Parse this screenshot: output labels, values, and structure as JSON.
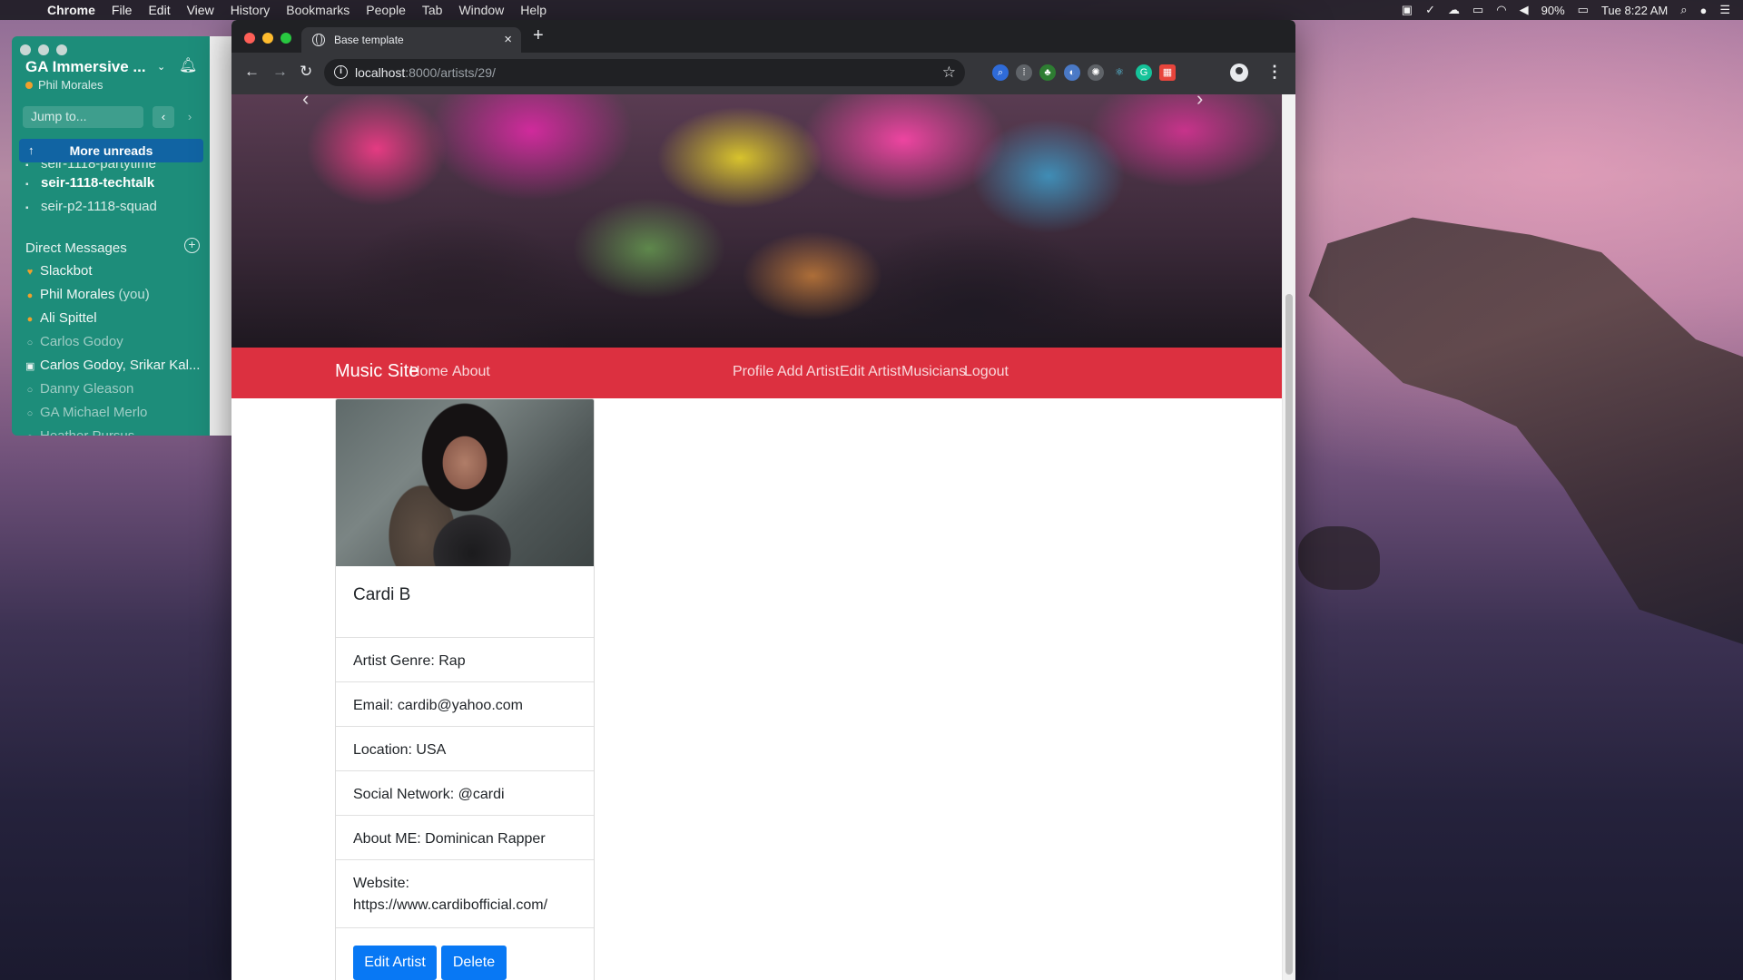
{
  "menubar": {
    "items": [
      "Chrome",
      "File",
      "Edit",
      "View",
      "History",
      "Bookmarks",
      "People",
      "Tab",
      "Window",
      "Help"
    ],
    "battery": "90%",
    "clock": "Tue 8:22 AM"
  },
  "slack": {
    "workspace": "GA Immersive ...",
    "user": "Phil Morales",
    "jump_placeholder": "Jump to...",
    "more_unreads": "More unreads",
    "channels": [
      {
        "label": "seir-1118-partytime"
      },
      {
        "label": "seir-1118-techtalk"
      },
      {
        "label": "seir-p2-1118-squad"
      }
    ],
    "dm_header": "Direct Messages",
    "dms": [
      {
        "label": "Slackbot",
        "suffix": ""
      },
      {
        "label": "Phil Morales",
        "suffix": "(you)"
      },
      {
        "label": "Ali Spittel",
        "suffix": ""
      },
      {
        "label": "Carlos Godoy",
        "suffix": ""
      },
      {
        "label": "Carlos Godoy, Srikar Kal...",
        "suffix": ""
      },
      {
        "label": "Danny Gleason",
        "suffix": ""
      },
      {
        "label": "GA Michael Merlo",
        "suffix": ""
      },
      {
        "label": "Heather Pursus",
        "suffix": ""
      }
    ]
  },
  "browser": {
    "tab_title": "Base template",
    "url_host": "localhost",
    "url_path": ":8000/artists/29/",
    "extensions": [
      "search",
      "pin",
      "tree",
      "circle",
      "settings",
      "react",
      "grammarly",
      "calendar"
    ]
  },
  "site": {
    "brand": "Music Site",
    "nav_left": [
      "Home",
      "About"
    ],
    "nav_right": [
      "Profile",
      "Add Artist",
      "Edit Artist",
      "Musicians",
      "Logout"
    ],
    "carousel_prev": "‹",
    "carousel_next": "›"
  },
  "artist": {
    "name": "Cardi B",
    "genre": "Artist Genre: Rap",
    "email": "Email: cardib@yahoo.com",
    "location": "Location: USA",
    "social": "Social Network: @cardi",
    "about": "About ME: Dominican Rapper",
    "website_label": "Website:",
    "website_url": "https://www.cardibofficial.com/",
    "edit_button": "Edit Artist",
    "delete_button": "Delete"
  },
  "colors": {
    "navbar": "#dc3040",
    "button": "#0878f4",
    "slack_sidebar": "#1d8d7a"
  }
}
